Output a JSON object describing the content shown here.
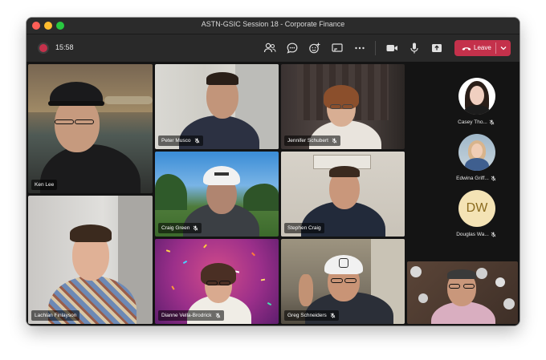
{
  "window": {
    "title": "ASTN-GSIC Session 18 - Corporate Finance"
  },
  "toolbar": {
    "timer": "15:58",
    "leave_label": "Leave",
    "icons": [
      "participants-icon",
      "chat-icon",
      "reactions-icon",
      "share-screen-icon",
      "more-options-icon",
      "camera-icon",
      "microphone-icon",
      "share-tray-icon"
    ]
  },
  "tiles": [
    {
      "name": "Ken Lee",
      "muted": false
    },
    {
      "name": "Peter Musco",
      "muted": true
    },
    {
      "name": "Jennifer Schubert",
      "muted": true
    },
    {
      "name": "Craig Green",
      "muted": true
    },
    {
      "name": "Stephen Craig",
      "muted": false,
      "active_speaker": true
    },
    {
      "name": "Lachlan Finlayson",
      "muted": false
    },
    {
      "name": "Dianne Vella-Brodrick",
      "muted": true
    },
    {
      "name": "Greg Schneiders",
      "muted": true
    }
  ],
  "sidebar": [
    {
      "name": "Casey Tho...",
      "muted": true
    },
    {
      "name": "Edwina Griff...",
      "muted": true
    },
    {
      "name": "Douglas Wa...",
      "muted": true,
      "initials": "DW"
    }
  ],
  "colors": {
    "leave": "#c4314b",
    "active_border": "#8b8cc7",
    "window_bg": "#1f1f1f"
  }
}
